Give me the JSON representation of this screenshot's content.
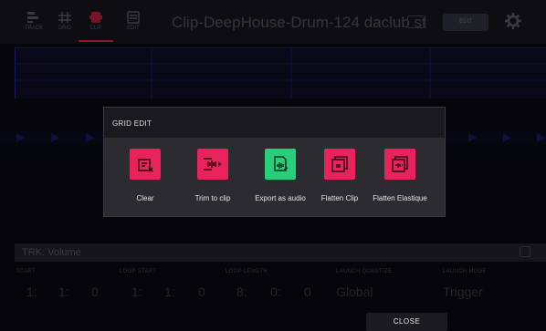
{
  "topbar": {
    "tabs": [
      {
        "label": "TRACK",
        "icon": "track-view-icon"
      },
      {
        "label": "GRID",
        "icon": "grid-view-icon"
      },
      {
        "label": "CLIP",
        "icon": "clip-view-icon"
      },
      {
        "label": "EDIT",
        "icon": "list-view-icon"
      }
    ],
    "title": "Clip-DeepHouse-Drum-124 daclub st",
    "edit_label": "EDIT"
  },
  "bottom": {
    "track_label": "TRK: Volume",
    "params": [
      {
        "header": "START",
        "values": [
          "1:",
          "1:",
          "0"
        ]
      },
      {
        "header": "LOOP START",
        "values": [
          "1:",
          "1:",
          "0"
        ]
      },
      {
        "header": "LOOP LENGTH",
        "values": [
          "8:",
          "0:",
          "0"
        ]
      },
      {
        "header": "LAUNCH QUANTIZE",
        "values": [
          "Global"
        ]
      },
      {
        "header": "LAUNCH MODE",
        "values": [
          "Trigger"
        ]
      }
    ],
    "close_label": "CLOSE"
  },
  "modal": {
    "title": "GRID EDIT",
    "actions": [
      {
        "label": "Clear",
        "icon": "clear-grid-icon",
        "color": "#e8225a"
      },
      {
        "label": "Trim to clip",
        "icon": "trim-to-clip-icon",
        "color": "#e8225a"
      },
      {
        "label": "Export as audio",
        "icon": "export-audio-icon",
        "color": "#28cf7a"
      },
      {
        "label": "Flatten Clip",
        "icon": "flatten-clip-icon",
        "color": "#e8225a"
      },
      {
        "label": "Flatten Elastique",
        "icon": "flatten-elastique-icon",
        "color": "#e8225a"
      }
    ]
  },
  "colors": {
    "accent_pink": "#e8225a",
    "accent_green": "#28cf7a",
    "modal_bg": "#2b2b30"
  }
}
